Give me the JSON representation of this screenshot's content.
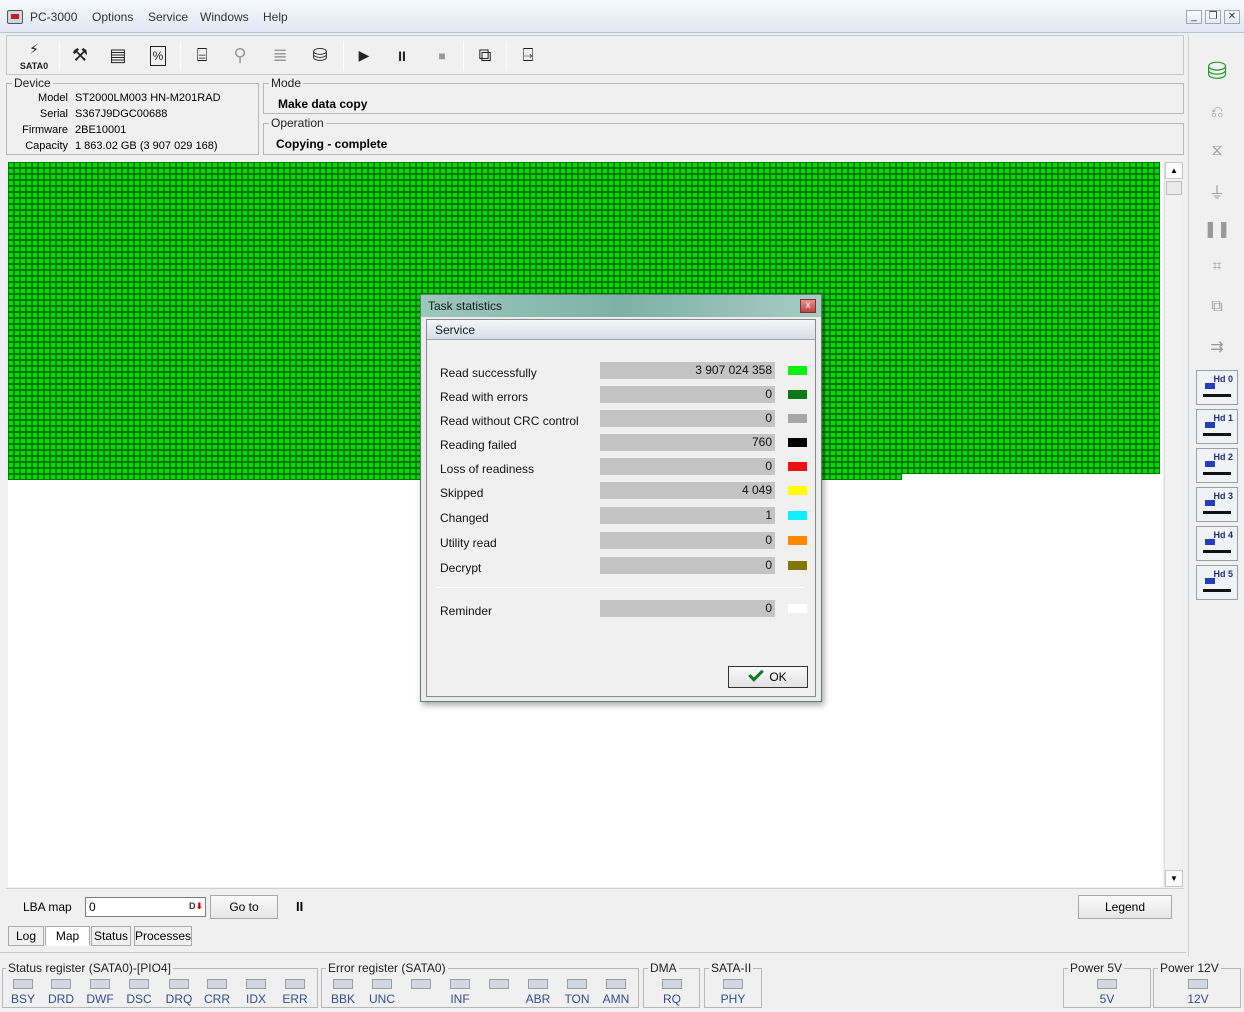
{
  "window": {
    "title": "PC-3000",
    "menu": [
      "Options",
      "Service",
      "Windows",
      "Help"
    ]
  },
  "toolbar": {
    "port_label": "SATA0"
  },
  "device": {
    "title": "Device",
    "model_label": "Model",
    "model": "ST2000LM003 HN-M201RAD",
    "serial_label": "Serial",
    "serial": "S367J9DGC00688",
    "firmware_label": "Firmware",
    "firmware": "2BE10001",
    "capacity_label": "Capacity",
    "capacity": "1 863.02 GB (3 907 029 168)"
  },
  "mode": {
    "title": "Mode",
    "value": "Make data copy"
  },
  "operation": {
    "title": "Operation",
    "value": "Copying - complete"
  },
  "map": {
    "fill_color": "#00e000",
    "cell_border_color": "#007a00",
    "background_color": "#ffffff",
    "full_rows": 52,
    "partial_row_fraction": 0.775
  },
  "bottom": {
    "lba_label": "LBA map",
    "lba_value": "0",
    "goto_label": "Go to",
    "pause_label": "II",
    "legend_label": "Legend"
  },
  "tabs": [
    "Log",
    "Map",
    "Status",
    "Processes"
  ],
  "registers": {
    "status": {
      "title": "Status register (SATA0)-[PIO4]",
      "bits": [
        "BSY",
        "DRD",
        "DWF",
        "DSC",
        "DRQ",
        "CRR",
        "IDX",
        "ERR"
      ]
    },
    "error": {
      "title": "Error register (SATA0)",
      "bits": [
        "BBK",
        "UNC",
        "",
        "INF",
        "",
        "ABR",
        "TON",
        "AMN"
      ]
    },
    "dma": {
      "title": "DMA",
      "bits": [
        "RQ"
      ]
    },
    "sata": {
      "title": "SATA-II",
      "bits": [
        "PHY"
      ]
    },
    "power5": {
      "title": "Power 5V",
      "bits": [
        "5V"
      ]
    },
    "power12": {
      "title": "Power 12V",
      "bits": [
        "12V"
      ]
    }
  },
  "side_panel": {
    "hd_items": [
      "Hd 0",
      "Hd 1",
      "Hd 2",
      "Hd 3",
      "Hd 4",
      "Hd 5"
    ]
  },
  "dialog": {
    "title": "Task statistics",
    "close_glyph": "x",
    "tab": "Service",
    "stats": [
      {
        "label": "Read successfully",
        "value": "3 907 024 358",
        "color": "#11ee11"
      },
      {
        "label": "Read with errors",
        "value": "0",
        "color": "#0b7a16"
      },
      {
        "label": "Read without CRC control",
        "value": "0",
        "color": "#a6a6a6"
      },
      {
        "label": "Reading failed",
        "value": "760",
        "color": "#000000"
      },
      {
        "label": "Loss of readiness",
        "value": "0",
        "color": "#ee1111"
      },
      {
        "label": "Skipped",
        "value": "4 049",
        "color": "#ffff00"
      },
      {
        "label": "Changed",
        "value": "1",
        "color": "#11eeff"
      },
      {
        "label": "Utility read",
        "value": "0",
        "color": "#ff8800"
      },
      {
        "label": "Decrypt",
        "value": "0",
        "color": "#807800"
      }
    ],
    "reminder": {
      "label": "Reminder",
      "value": "0",
      "color": "#ffffff"
    },
    "ok_label": "OK"
  }
}
